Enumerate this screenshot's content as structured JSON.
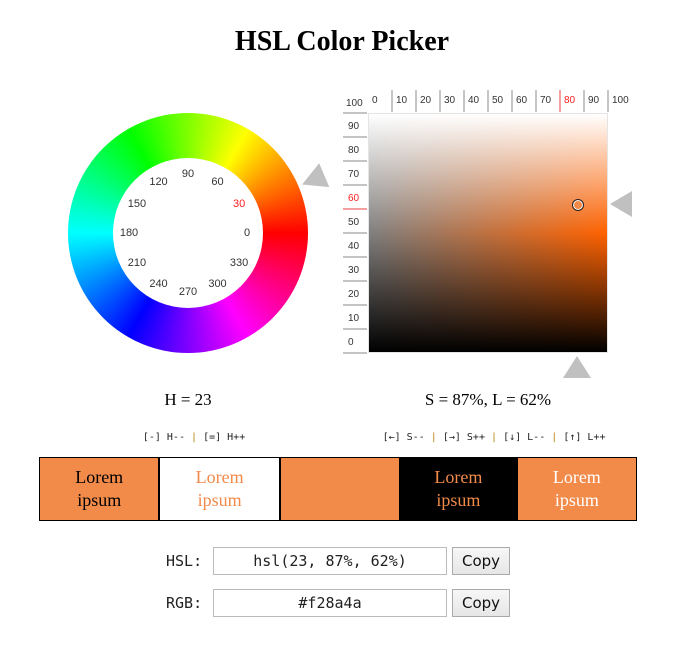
{
  "title": "HSL Color Picker",
  "color": {
    "h": 23,
    "s": 87,
    "l": 62,
    "hex": "#f28a4a"
  },
  "hue_wheel": {
    "labels": [
      "0",
      "30",
      "60",
      "90",
      "120",
      "150",
      "180",
      "210",
      "240",
      "270",
      "300",
      "330"
    ],
    "active_label": "30"
  },
  "sl_square": {
    "top_ruler": [
      "0",
      "10",
      "20",
      "30",
      "40",
      "50",
      "60",
      "70",
      "80",
      "90",
      "100"
    ],
    "top_active": "80",
    "corner_label": "100",
    "left_ruler": [
      "90",
      "80",
      "70",
      "60",
      "50",
      "40",
      "30",
      "20",
      "10",
      "0"
    ],
    "left_active": "60"
  },
  "readouts": {
    "hue": "H = 23",
    "sl": "S = 87%, L = 62%"
  },
  "shortcuts": {
    "hue": [
      {
        "key": "[-]",
        "action": "H--"
      },
      {
        "key": "[=]",
        "action": "H++"
      }
    ],
    "sl": [
      {
        "key": "[←]",
        "action": "S--"
      },
      {
        "key": "[→]",
        "action": "S++"
      },
      {
        "key": "[↓]",
        "action": "L--"
      },
      {
        "key": "[↑]",
        "action": "L++"
      }
    ]
  },
  "swatches": [
    {
      "text": "Lorem ipsum",
      "bg": "#f28a4a",
      "fg": "#000000"
    },
    {
      "text": "Lorem ipsum",
      "bg": "#ffffff",
      "fg": "#f28a4a"
    },
    {
      "text": "",
      "bg": "#f28a4a",
      "fg": "#f28a4a"
    },
    {
      "text": "Lorem ipsum",
      "bg": "#000000",
      "fg": "#f28a4a"
    },
    {
      "text": "Lorem ipsum",
      "bg": "#f28a4a",
      "fg": "#ffffff"
    }
  ],
  "fields": {
    "hsl": {
      "label": "HSL:",
      "value": "hsl(23, 87%, 62%)",
      "button": "Copy"
    },
    "rgb": {
      "label": "RGB:",
      "value": "#f28a4a",
      "button": "Copy"
    }
  },
  "icons": {
    "hue_pointer": "triangle-pointer-icon",
    "saturation_pointer": "triangle-up-icon",
    "lightness_pointer": "triangle-left-icon",
    "marker": "circle-marker-icon"
  }
}
